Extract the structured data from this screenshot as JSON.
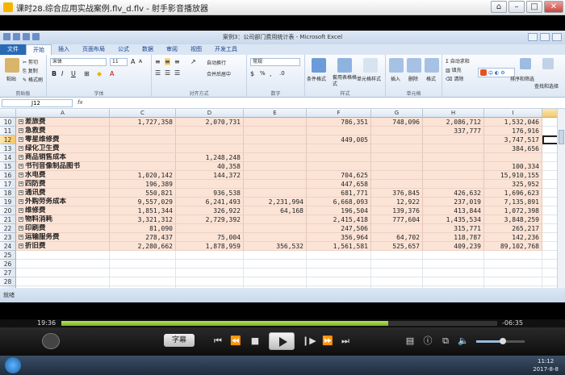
{
  "player": {
    "title": "课时28.综合应用实战案例.flv_d.flv - 射手影音播放器",
    "time_elapsed": "19:36",
    "time_remaining": "-06:35",
    "progress_fraction": 0.75,
    "subtitle_label": "字幕",
    "volume_fraction": 0.55
  },
  "excel": {
    "window_title": "案例3：公司部门费用统计表 - Microsoft Excel",
    "tabs": [
      "文件",
      "开始",
      "插入",
      "页面布局",
      "公式",
      "数据",
      "审阅",
      "视图",
      "开发工具"
    ],
    "active_tab": "开始",
    "ribbon": {
      "clipboard": {
        "paste": "粘贴",
        "cut": "剪切",
        "copy": "复制",
        "format_painter": "格式刷",
        "label": "剪贴板"
      },
      "font": {
        "name": "宋体",
        "size": "11",
        "label": "字体",
        "bold": "B",
        "italic": "I",
        "underline": "U",
        "grow": "A",
        "shrink": "A",
        "color": "A"
      },
      "alignment": {
        "wrap": "自动换行",
        "merge": "合并后居中",
        "label": "对齐方式"
      },
      "number": {
        "format": "常规",
        "label": "数字",
        "percent": "%",
        "comma": ","
      },
      "styles": {
        "conditional": "条件格式",
        "table": "套用表格格式",
        "cell": "单元格样式",
        "label": "样式"
      },
      "cells": {
        "insert": "插入",
        "delete": "删除",
        "format": "格式",
        "label": "单元格"
      },
      "editing": {
        "autosum": "自动求和",
        "fill": "填充",
        "clear": "清除",
        "sort": "排序和筛选",
        "find": "查找和选择"
      }
    },
    "name_box": "J12",
    "fx": "fx",
    "columns": [
      "A",
      "C",
      "D",
      "E",
      "F",
      "G",
      "H",
      "I",
      "J"
    ],
    "selected_column": "J",
    "selected_row": "12",
    "rows": [
      {
        "row": "10",
        "name": "差旅费",
        "values": [
          "1,727,358",
          "2,070,731",
          "",
          "786,351",
          "748,096",
          "2,086,712",
          "1,532,046"
        ]
      },
      {
        "row": "11",
        "name": "急救费",
        "values": [
          "",
          "",
          "",
          "",
          "",
          "337,777",
          "176,916"
        ]
      },
      {
        "row": "12",
        "name": "零星维修费",
        "values": [
          "",
          "",
          "",
          "449,005",
          "",
          "",
          "3,747,517"
        ]
      },
      {
        "row": "13",
        "name": "绿化卫生费",
        "values": [
          "",
          "",
          "",
          "",
          "",
          "",
          "384,656"
        ]
      },
      {
        "row": "14",
        "name": "商品销售成本",
        "values": [
          "",
          "1,248,248",
          "",
          "",
          "",
          "",
          ""
        ]
      },
      {
        "row": "15",
        "name": "书刊音像制品图书",
        "values": [
          "",
          "40,358",
          "",
          "",
          "",
          "",
          "100,334"
        ]
      },
      {
        "row": "16",
        "name": "水电费",
        "values": [
          "1,020,142",
          "144,372",
          "",
          "704,625",
          "",
          "",
          "15,910,155"
        ]
      },
      {
        "row": "17",
        "name": "四防费",
        "values": [
          "196,389",
          "",
          "",
          "447,658",
          "",
          "",
          "325,952"
        ]
      },
      {
        "row": "18",
        "name": "通讯费",
        "values": [
          "550,821",
          "936,538",
          "",
          "681,771",
          "376,845",
          "426,632",
          "1,696,623"
        ]
      },
      {
        "row": "19",
        "name": "外购劳务成本",
        "values": [
          "9,557,029",
          "6,241,493",
          "2,231,994",
          "6,668,093",
          "12,922",
          "237,019",
          "7,135,891"
        ]
      },
      {
        "row": "20",
        "name": "维修费",
        "values": [
          "1,851,344",
          "326,922",
          "64,168",
          "196,504",
          "139,376",
          "413,844",
          "1,072,398"
        ]
      },
      {
        "row": "21",
        "name": "物料消耗",
        "values": [
          "3,321,312",
          "2,729,392",
          "",
          "2,415,418",
          "777,604",
          "1,435,534",
          "3,848,259"
        ]
      },
      {
        "row": "22",
        "name": "印刷费",
        "values": [
          "81,090",
          "",
          "",
          "247,506",
          "",
          "315,771",
          "265,217"
        ]
      },
      {
        "row": "23",
        "name": "运输服务费",
        "values": [
          "278,437",
          "75,004",
          "",
          "356,964",
          "64,702",
          "118,787",
          "142,236"
        ]
      },
      {
        "row": "24",
        "name": "折旧费",
        "values": [
          "2,280,662",
          "1,878,959",
          "356,532",
          "1,561,581",
          "525,657",
          "409,239",
          "89,102,768"
        ]
      },
      {
        "row": "25",
        "name": "",
        "values": [
          "",
          "",
          "",
          "",
          "",
          "",
          ""
        ]
      },
      {
        "row": "26",
        "name": "",
        "values": [
          "",
          "",
          "",
          "",
          "",
          "",
          ""
        ]
      },
      {
        "row": "27",
        "name": "",
        "values": [
          "",
          "",
          "",
          "",
          "",
          "",
          ""
        ]
      },
      {
        "row": "28",
        "name": "",
        "values": [
          "",
          "",
          "",
          "",
          "",
          "",
          ""
        ]
      },
      {
        "row": "29",
        "name": "",
        "values": [
          "",
          "",
          "",
          "",
          "",
          "",
          ""
        ]
      },
      {
        "row": "30",
        "name": "",
        "values": [
          "",
          "",
          "",
          "",
          "",
          "",
          ""
        ]
      },
      {
        "row": "31",
        "name": "",
        "values": [
          "",
          "",
          "",
          "",
          "",
          "",
          ""
        ]
      },
      {
        "row": "32",
        "name": "",
        "values": [
          "",
          "",
          "",
          "",
          "",
          "",
          ""
        ]
      }
    ],
    "status": "就绪"
  },
  "taskbar": {
    "time": "11:12",
    "date": "2017-8-8"
  }
}
